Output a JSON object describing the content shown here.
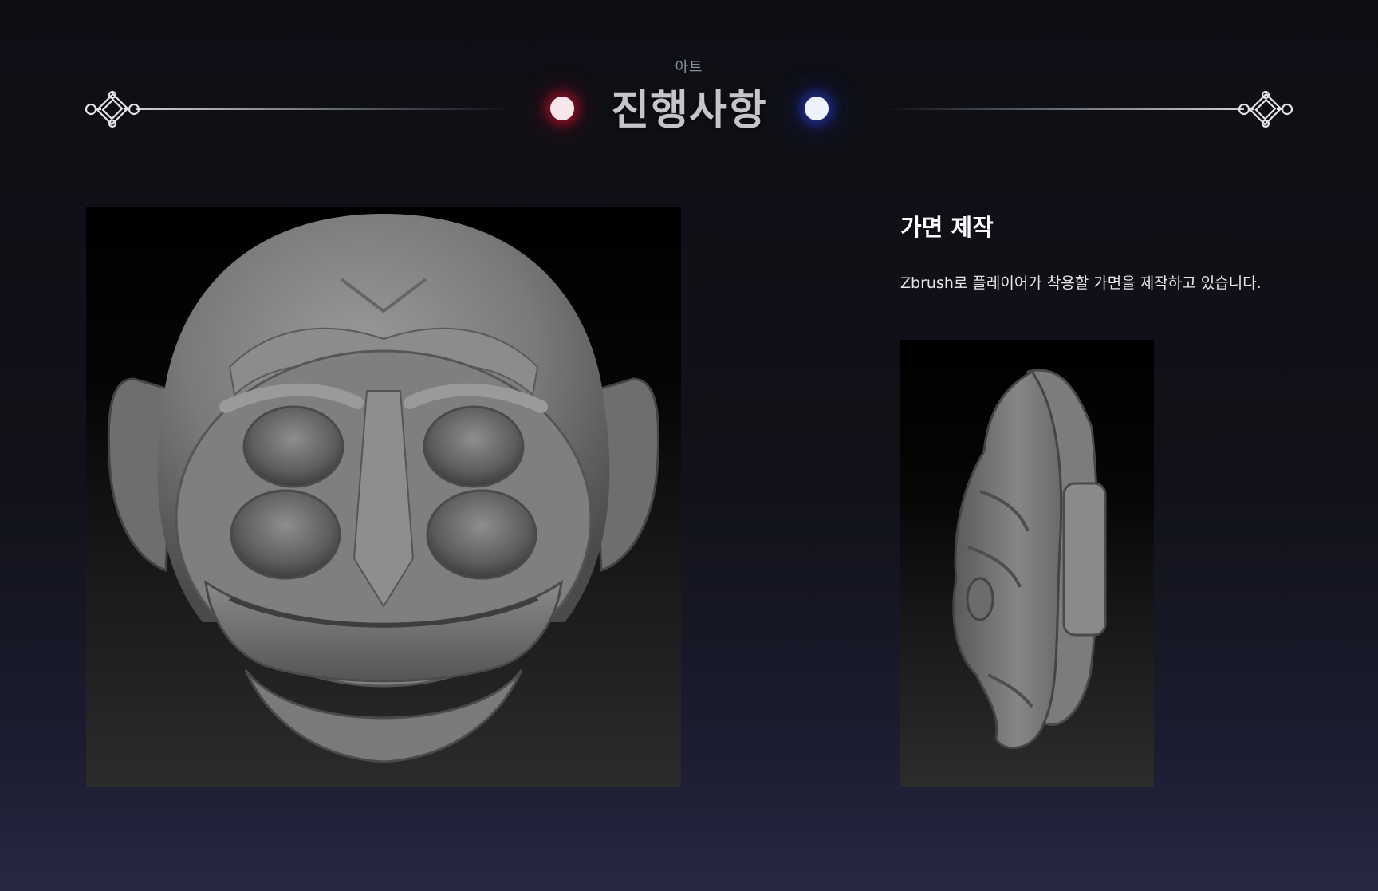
{
  "header": {
    "eyebrow": "아트",
    "title": "진행사항",
    "left_ornament_icon": "endless-knot-icon",
    "right_ornament_icon": "endless-knot-icon",
    "orb_colors": [
      "#d01a3c",
      "#2a3ccc"
    ]
  },
  "item": {
    "title": "가면 제작",
    "description": "Zbrush로 플레이어가 착용할 가면을 제작하고 있습니다.",
    "main_image": "mask-front-render",
    "side_image": "mask-side-render"
  },
  "colors": {
    "background_top": "#0e0f15",
    "background_bottom": "#272842",
    "text": "#ffffff",
    "title": "#c4c6cb"
  }
}
